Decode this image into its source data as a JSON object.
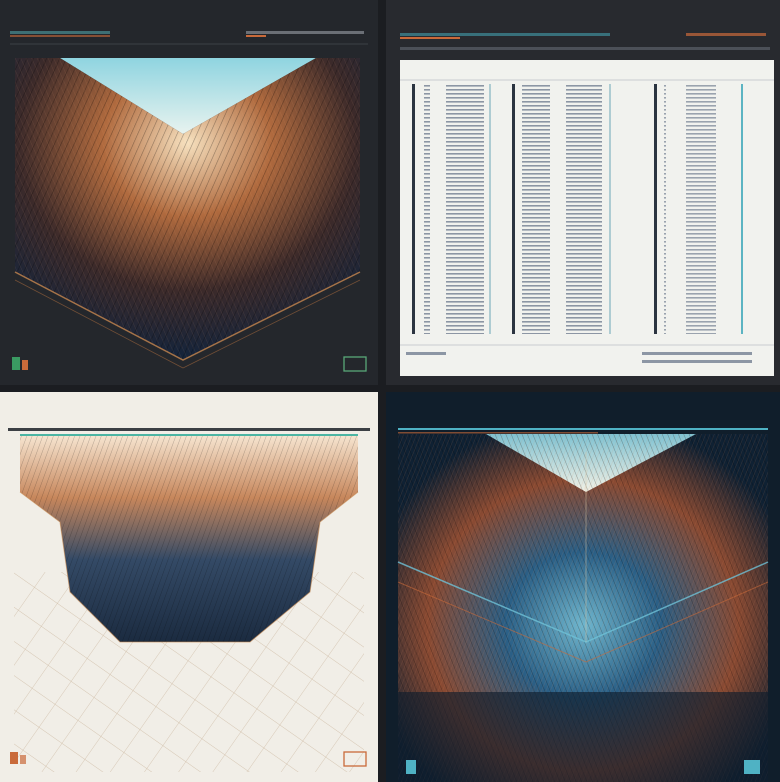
{
  "panels": [
    {
      "id": "top-left",
      "theme": "dark",
      "header_title": "",
      "header_subtitle": "",
      "footer_left": "",
      "footer_right": ""
    },
    {
      "id": "top-right",
      "theme": "document",
      "header_title": "",
      "header_subtitle": "",
      "doc_heading_left": "",
      "doc_heading_right": ""
    },
    {
      "id": "bottom-left",
      "theme": "light",
      "header_title": "",
      "header_subtitle": "",
      "header_right": ""
    },
    {
      "id": "bottom-right",
      "theme": "dark-blue",
      "header_title": "",
      "header_subtitle": "",
      "header_right": ""
    }
  ],
  "colors": {
    "background": "#1b1d21",
    "panel_dark": "#24272c",
    "panel_light": "#f1eee7",
    "panel_navy": "#0e2233",
    "accent_orange": "#c96a3a",
    "accent_teal": "#4fb2c4",
    "accent_cream": "#f4e6cc"
  }
}
